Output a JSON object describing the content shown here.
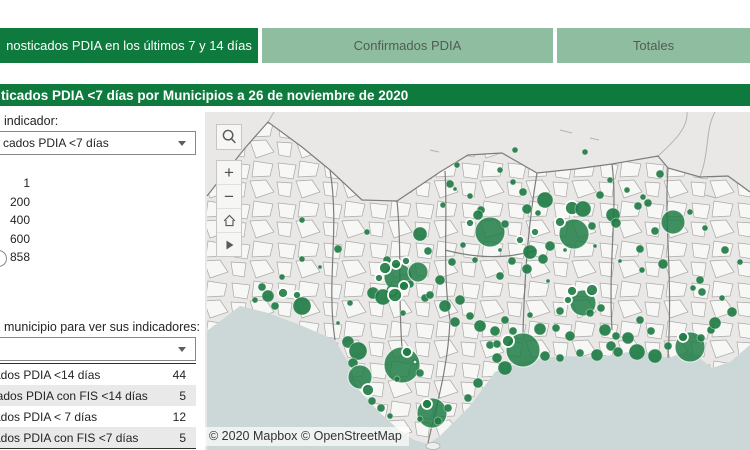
{
  "theme": {
    "dark_green": "#0f7a3e",
    "tab_light_green": "#8fbda0",
    "bubble_green": "#1f7c45",
    "sea": "#cbd8d7",
    "land": "#e9e8e6"
  },
  "tabs": [
    {
      "label": "nosticados PDIA en los últimos 7 y 14 días",
      "active": true
    },
    {
      "label": "Confirmados PDIA",
      "active": false
    },
    {
      "label": "Totales",
      "active": false
    }
  ],
  "title_bar": {
    "text": "ticados PDIA <7 días por Municipios a 26 de noviembre de 2020"
  },
  "sidebar": {
    "indicator_label": "indicador:",
    "indicator_value": "cados PDIA <7 días",
    "size_legend": {
      "values": [
        "1",
        "200",
        "400",
        "600",
        "858"
      ]
    },
    "municipality_label": "municipio para ver sus indicadores:",
    "municipality_value": "",
    "table": {
      "rows": [
        {
          "label": "cados PDIA <14 días",
          "value": "44"
        },
        {
          "label": "icados PDIA con FIS <14 días",
          "value": "5"
        },
        {
          "label": "cados PDIA < 7 días",
          "value": "12"
        },
        {
          "label": "cados PDIA con FIS <7 días",
          "value": "5"
        }
      ]
    }
  },
  "map": {
    "attribution": "© 2020 Mapbox © OpenStreetMap",
    "controls": [
      "search",
      "zoom-in",
      "zoom-out",
      "home",
      "play"
    ],
    "bubbles": [
      [
        302,
        220,
        3
      ],
      [
        457,
        165,
        3
      ],
      [
        450,
        184,
        4
      ],
      [
        455,
        189,
        2
      ],
      [
        443,
        205,
        3
      ],
      [
        470,
        196,
        3
      ],
      [
        481,
        210,
        4
      ],
      [
        515,
        150,
        3
      ],
      [
        500,
        170,
        3
      ],
      [
        513,
        182,
        3
      ],
      [
        585,
        152,
        3
      ],
      [
        600,
        195,
        4
      ],
      [
        610,
        180,
        3
      ],
      [
        627,
        190,
        3
      ],
      [
        660,
        174,
        4
      ],
      [
        643,
        197,
        3
      ],
      [
        648,
        203,
        4
      ],
      [
        638,
        206,
        4
      ],
      [
        673,
        222,
        12
      ],
      [
        690,
        212,
        3
      ],
      [
        705,
        228,
        3
      ],
      [
        725,
        250,
        4
      ],
      [
        740,
        262,
        3
      ],
      [
        490,
        232,
        15
      ],
      [
        478,
        215,
        5
      ],
      [
        470,
        223,
        4,
        1
      ],
      [
        505,
        224,
        4
      ],
      [
        523,
        192,
        4
      ],
      [
        527,
        209,
        5
      ],
      [
        545,
        200,
        8
      ],
      [
        538,
        213,
        3
      ],
      [
        530,
        252,
        7
      ],
      [
        543,
        259,
        5
      ],
      [
        527,
        269,
        5
      ],
      [
        520,
        240,
        4,
        1
      ],
      [
        535,
        232,
        4,
        1
      ],
      [
        550,
        246,
        5
      ],
      [
        512,
        261,
        4
      ],
      [
        500,
        276,
        4
      ],
      [
        574,
        234,
        15
      ],
      [
        572,
        208,
        7,
        1
      ],
      [
        583,
        209,
        8
      ],
      [
        560,
        222,
        5,
        1
      ],
      [
        592,
        226,
        4
      ],
      [
        613,
        215,
        7
      ],
      [
        616,
        223,
        5
      ],
      [
        655,
        231,
        4
      ],
      [
        640,
        249,
        4
      ],
      [
        663,
        264,
        5
      ],
      [
        642,
        270,
        3
      ],
      [
        282,
        277,
        3
      ],
      [
        302,
        259,
        3
      ],
      [
        320,
        267,
        2
      ],
      [
        262,
        287,
        4
      ],
      [
        268,
        296,
        6
      ],
      [
        283,
        293,
        5,
        1
      ],
      [
        297,
        295,
        4,
        1
      ],
      [
        302,
        306,
        9
      ],
      [
        275,
        306,
        4
      ],
      [
        255,
        300,
        3
      ],
      [
        338,
        249,
        4
      ],
      [
        367,
        232,
        3
      ],
      [
        387,
        260,
        4
      ],
      [
        420,
        234,
        7
      ],
      [
        428,
        251,
        4
      ],
      [
        398,
        277,
        14
      ],
      [
        418,
        272,
        10
      ],
      [
        385,
        268,
        6,
        1
      ],
      [
        396,
        264,
        5,
        1
      ],
      [
        406,
        261,
        4,
        1
      ],
      [
        379,
        278,
        4,
        1
      ],
      [
        410,
        284,
        4
      ],
      [
        392,
        291,
        5,
        2
      ],
      [
        373,
        293,
        6
      ],
      [
        383,
        297,
        8
      ],
      [
        395,
        295,
        7,
        1
      ],
      [
        404,
        286,
        5,
        1
      ],
      [
        425,
        298,
        4
      ],
      [
        403,
        313,
        3
      ],
      [
        350,
        303,
        3
      ],
      [
        338,
        323,
        2
      ],
      [
        452,
        262,
        4
      ],
      [
        463,
        245,
        3
      ],
      [
        475,
        260,
        3
      ],
      [
        440,
        280,
        5
      ],
      [
        430,
        295,
        4
      ],
      [
        445,
        306,
        6
      ],
      [
        460,
        300,
        5
      ],
      [
        470,
        316,
        4
      ],
      [
        455,
        322,
        5
      ],
      [
        480,
        326,
        6
      ],
      [
        495,
        331,
        5
      ],
      [
        505,
        320,
        4
      ],
      [
        530,
        315,
        3
      ],
      [
        548,
        281,
        2
      ],
      [
        565,
        250,
        2
      ],
      [
        595,
        246,
        2
      ],
      [
        620,
        261,
        2
      ],
      [
        500,
        250,
        2
      ],
      [
        583,
        303,
        13
      ],
      [
        572,
        291,
        5,
        1
      ],
      [
        592,
        290,
        6,
        1
      ],
      [
        568,
        300,
        4,
        1
      ],
      [
        590,
        313,
        4
      ],
      [
        601,
        308,
        4
      ],
      [
        560,
        311,
        4
      ],
      [
        556,
        328,
        4
      ],
      [
        570,
        336,
        5
      ],
      [
        605,
        330,
        6
      ],
      [
        616,
        336,
        4
      ],
      [
        628,
        338,
        6
      ],
      [
        611,
        346,
        5
      ],
      [
        540,
        329,
        6
      ],
      [
        640,
        320,
        4
      ],
      [
        651,
        331,
        4
      ],
      [
        348,
        342,
        6
      ],
      [
        358,
        351,
        9
      ],
      [
        353,
        363,
        5
      ],
      [
        360,
        377,
        12
      ],
      [
        368,
        390,
        6,
        1
      ],
      [
        372,
        401,
        4
      ],
      [
        381,
        408,
        4
      ],
      [
        390,
        416,
        3
      ],
      [
        402,
        365,
        18
      ],
      [
        407,
        352,
        5,
        1
      ],
      [
        415,
        362,
        2,
        2
      ],
      [
        397,
        379,
        3
      ],
      [
        420,
        373,
        4
      ],
      [
        432,
        413,
        15
      ],
      [
        427,
        404,
        5,
        1
      ],
      [
        438,
        421,
        4
      ],
      [
        420,
        419,
        3
      ],
      [
        448,
        408,
        4
      ],
      [
        468,
        398,
        4
      ],
      [
        478,
        383,
        5
      ],
      [
        497,
        358,
        5
      ],
      [
        505,
        368,
        7
      ],
      [
        490,
        345,
        4
      ],
      [
        523,
        350,
        17
      ],
      [
        508,
        341,
        6,
        1
      ],
      [
        497,
        344,
        4
      ],
      [
        513,
        331,
        4
      ],
      [
        545,
        356,
        5
      ],
      [
        560,
        358,
        4
      ],
      [
        580,
        353,
        4
      ],
      [
        597,
        355,
        6
      ],
      [
        618,
        352,
        5
      ],
      [
        637,
        352,
        8
      ],
      [
        655,
        356,
        7
      ],
      [
        668,
        346,
        4
      ],
      [
        690,
        347,
        15
      ],
      [
        683,
        337,
        5,
        1
      ],
      [
        701,
        338,
        4
      ],
      [
        711,
        330,
        4
      ],
      [
        715,
        323,
        6
      ],
      [
        732,
        312,
        5
      ],
      [
        722,
        298,
        3
      ],
      [
        702,
        292,
        4
      ],
      [
        693,
        288,
        3
      ],
      [
        700,
        280,
        4
      ]
    ]
  }
}
